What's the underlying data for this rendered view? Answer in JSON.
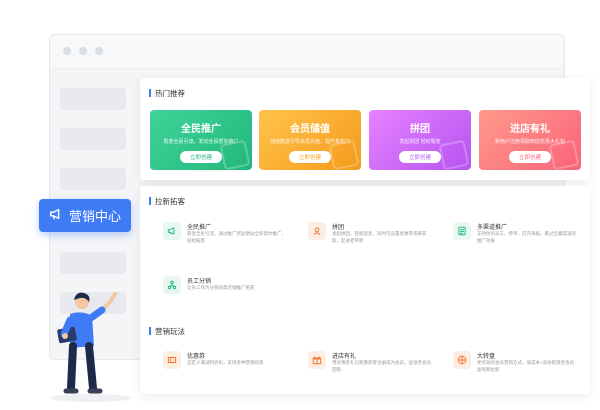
{
  "marketing_tag": {
    "label": "营销中心"
  },
  "hot": {
    "title": "热门推荐",
    "cards": [
      {
        "title": "全民推广",
        "desc": "裂变全民引流，发动全民帮你推广",
        "button": "立即创建",
        "color_from": "#3fd39a",
        "color_to": "#22b77a",
        "btn_color": "#22b77a"
      },
      {
        "title": "会员储值",
        "desc": "储值赠送引导会员充值，提升复购力",
        "button": "立即创建",
        "color_from": "#ffc34a",
        "color_to": "#f59b1c",
        "btn_color": "#f59b1c"
      },
      {
        "title": "拼团",
        "desc": "发起拼团 轻松裂变",
        "button": "立即创建",
        "color_from": "#e682ff",
        "color_to": "#b554f0",
        "btn_color": "#b554f0"
      },
      {
        "title": "进店有礼",
        "desc": "新用户注册领取到店优惠大礼包",
        "button": "立即创建",
        "color_from": "#ff9a8a",
        "color_to": "#f9637a",
        "btn_color": "#f9637a"
      }
    ]
  },
  "acquire": {
    "title": "拉新拓客",
    "items": [
      {
        "title": "全民推广",
        "desc": "裂变全民引流，通过推广奖励激励全民帮你推广，轻松拓客",
        "icon": "megaphone-icon",
        "color": "#22b77a",
        "bg": "#e6f8f0"
      },
      {
        "title": "拼团",
        "desc": "发起拼团，轻松裂变，同时可设置优惠券等来获取，促进老带新",
        "icon": "group-icon",
        "color": "#f3732a",
        "bg": "#fdeee4"
      },
      {
        "title": "多渠道推广",
        "desc": "支持你的员工、传单、店内海报，看过宝藏渠道的推广效果",
        "icon": "document-icon",
        "color": "#22b77a",
        "bg": "#e6f8f0"
      },
      {
        "title": "员工分销",
        "desc": "让员工作为分销员帮店铺推广拓客",
        "icon": "team-icon",
        "color": "#22b77a",
        "bg": "#e6f8f0"
      }
    ]
  },
  "play": {
    "title": "营销玩法",
    "items": [
      {
        "title": "优惠券",
        "desc": "自定义满减和折扣，支持多种营销场景",
        "icon": "coupon-icon",
        "color": "#f3732a",
        "bg": "#fdeee4"
      },
      {
        "title": "进店有礼",
        "desc": "用优惠券礼包刺激新客注册成为会员，促进老会员回购",
        "icon": "gift-icon",
        "color": "#f3732a",
        "bg": "#fdeee4"
      },
      {
        "title": "大转盘",
        "desc": "更有效的会员营销方式，低成本+高效刺激老会员复购和拉新",
        "icon": "wheel-icon",
        "color": "#f3732a",
        "bg": "#fdeee4"
      }
    ]
  }
}
